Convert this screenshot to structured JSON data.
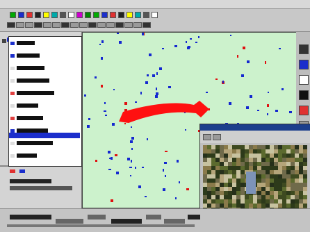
{
  "app": {
    "title": ""
  },
  "colors": {
    "map_background": "#ccf2cc",
    "feature_blue": "#1428d0",
    "feature_red": "#e01010",
    "flow_arrow": "#ff1010",
    "caption_bar": "#1c3e8c"
  },
  "icons": {
    "toolbar": [
      "open-icon",
      "save-icon",
      "print-icon",
      "zoom-in-icon",
      "zoom-out-icon",
      "pan-icon",
      "identify-icon",
      "select-icon",
      "measure-icon",
      "layer-icon",
      "legend-icon",
      "photo-icon",
      "query-icon",
      "refresh-icon",
      "help-icon",
      "grid-icon",
      "globe-icon",
      "info-icon"
    ]
  },
  "layers": [
    {
      "swatch": "#1b2ecc"
    },
    {
      "swatch": "#1b2ecc"
    },
    {
      "swatch": "#dddddd"
    },
    {
      "swatch": "#dddddd"
    },
    {
      "swatch": "#e04040"
    },
    {
      "swatch": "#dddddd"
    },
    {
      "swatch": "#e04040"
    },
    {
      "swatch": "#1b2ecc"
    },
    {
      "swatch": "#dddddd"
    },
    {
      "swatch": "#dddddd"
    }
  ],
  "photo": {
    "caption": ""
  }
}
